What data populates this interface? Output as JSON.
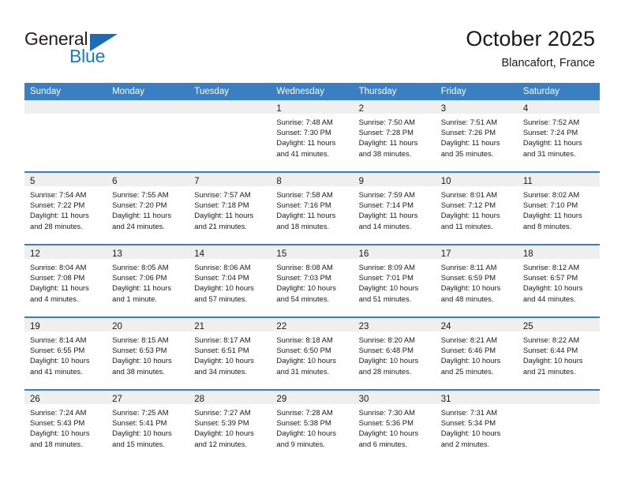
{
  "brand": {
    "name_part1": "General",
    "name_part2": "Blue",
    "logo_icon": "triangle-logo-icon",
    "color_text": "#231f20",
    "color_accent": "#1c79c0"
  },
  "header": {
    "title": "October 2025",
    "subtitle": "Blancafort, France"
  },
  "theme": {
    "header_row_bg": "#3a7fc1",
    "date_band_bg": "#efefef",
    "row_separator": "#3a7fc1",
    "text": "#1a1a1a"
  },
  "weekday_headers": [
    "Sunday",
    "Monday",
    "Tuesday",
    "Wednesday",
    "Thursday",
    "Friday",
    "Saturday"
  ],
  "labels": {
    "sunrise_prefix": "Sunrise:",
    "sunset_prefix": "Sunset:",
    "daylight_prefix": "Daylight:"
  },
  "weeks": [
    [
      {
        "empty": true
      },
      {
        "empty": true
      },
      {
        "empty": true
      },
      {
        "empty": false,
        "day": "1",
        "sunrise": "Sunrise: 7:48 AM",
        "sunset": "Sunset: 7:30 PM",
        "daylight_line1": "Daylight: 11 hours",
        "daylight_line2": "and 41 minutes."
      },
      {
        "empty": false,
        "day": "2",
        "sunrise": "Sunrise: 7:50 AM",
        "sunset": "Sunset: 7:28 PM",
        "daylight_line1": "Daylight: 11 hours",
        "daylight_line2": "and 38 minutes."
      },
      {
        "empty": false,
        "day": "3",
        "sunrise": "Sunrise: 7:51 AM",
        "sunset": "Sunset: 7:26 PM",
        "daylight_line1": "Daylight: 11 hours",
        "daylight_line2": "and 35 minutes."
      },
      {
        "empty": false,
        "day": "4",
        "sunrise": "Sunrise: 7:52 AM",
        "sunset": "Sunset: 7:24 PM",
        "daylight_line1": "Daylight: 11 hours",
        "daylight_line2": "and 31 minutes."
      }
    ],
    [
      {
        "empty": false,
        "day": "5",
        "sunrise": "Sunrise: 7:54 AM",
        "sunset": "Sunset: 7:22 PM",
        "daylight_line1": "Daylight: 11 hours",
        "daylight_line2": "and 28 minutes."
      },
      {
        "empty": false,
        "day": "6",
        "sunrise": "Sunrise: 7:55 AM",
        "sunset": "Sunset: 7:20 PM",
        "daylight_line1": "Daylight: 11 hours",
        "daylight_line2": "and 24 minutes."
      },
      {
        "empty": false,
        "day": "7",
        "sunrise": "Sunrise: 7:57 AM",
        "sunset": "Sunset: 7:18 PM",
        "daylight_line1": "Daylight: 11 hours",
        "daylight_line2": "and 21 minutes."
      },
      {
        "empty": false,
        "day": "8",
        "sunrise": "Sunrise: 7:58 AM",
        "sunset": "Sunset: 7:16 PM",
        "daylight_line1": "Daylight: 11 hours",
        "daylight_line2": "and 18 minutes."
      },
      {
        "empty": false,
        "day": "9",
        "sunrise": "Sunrise: 7:59 AM",
        "sunset": "Sunset: 7:14 PM",
        "daylight_line1": "Daylight: 11 hours",
        "daylight_line2": "and 14 minutes."
      },
      {
        "empty": false,
        "day": "10",
        "sunrise": "Sunrise: 8:01 AM",
        "sunset": "Sunset: 7:12 PM",
        "daylight_line1": "Daylight: 11 hours",
        "daylight_line2": "and 11 minutes."
      },
      {
        "empty": false,
        "day": "11",
        "sunrise": "Sunrise: 8:02 AM",
        "sunset": "Sunset: 7:10 PM",
        "daylight_line1": "Daylight: 11 hours",
        "daylight_line2": "and 8 minutes."
      }
    ],
    [
      {
        "empty": false,
        "day": "12",
        "sunrise": "Sunrise: 8:04 AM",
        "sunset": "Sunset: 7:08 PM",
        "daylight_line1": "Daylight: 11 hours",
        "daylight_line2": "and 4 minutes."
      },
      {
        "empty": false,
        "day": "13",
        "sunrise": "Sunrise: 8:05 AM",
        "sunset": "Sunset: 7:06 PM",
        "daylight_line1": "Daylight: 11 hours",
        "daylight_line2": "and 1 minute."
      },
      {
        "empty": false,
        "day": "14",
        "sunrise": "Sunrise: 8:06 AM",
        "sunset": "Sunset: 7:04 PM",
        "daylight_line1": "Daylight: 10 hours",
        "daylight_line2": "and 57 minutes."
      },
      {
        "empty": false,
        "day": "15",
        "sunrise": "Sunrise: 8:08 AM",
        "sunset": "Sunset: 7:03 PM",
        "daylight_line1": "Daylight: 10 hours",
        "daylight_line2": "and 54 minutes."
      },
      {
        "empty": false,
        "day": "16",
        "sunrise": "Sunrise: 8:09 AM",
        "sunset": "Sunset: 7:01 PM",
        "daylight_line1": "Daylight: 10 hours",
        "daylight_line2": "and 51 minutes."
      },
      {
        "empty": false,
        "day": "17",
        "sunrise": "Sunrise: 8:11 AM",
        "sunset": "Sunset: 6:59 PM",
        "daylight_line1": "Daylight: 10 hours",
        "daylight_line2": "and 48 minutes."
      },
      {
        "empty": false,
        "day": "18",
        "sunrise": "Sunrise: 8:12 AM",
        "sunset": "Sunset: 6:57 PM",
        "daylight_line1": "Daylight: 10 hours",
        "daylight_line2": "and 44 minutes."
      }
    ],
    [
      {
        "empty": false,
        "day": "19",
        "sunrise": "Sunrise: 8:14 AM",
        "sunset": "Sunset: 6:55 PM",
        "daylight_line1": "Daylight: 10 hours",
        "daylight_line2": "and 41 minutes."
      },
      {
        "empty": false,
        "day": "20",
        "sunrise": "Sunrise: 8:15 AM",
        "sunset": "Sunset: 6:53 PM",
        "daylight_line1": "Daylight: 10 hours",
        "daylight_line2": "and 38 minutes."
      },
      {
        "empty": false,
        "day": "21",
        "sunrise": "Sunrise: 8:17 AM",
        "sunset": "Sunset: 6:51 PM",
        "daylight_line1": "Daylight: 10 hours",
        "daylight_line2": "and 34 minutes."
      },
      {
        "empty": false,
        "day": "22",
        "sunrise": "Sunrise: 8:18 AM",
        "sunset": "Sunset: 6:50 PM",
        "daylight_line1": "Daylight: 10 hours",
        "daylight_line2": "and 31 minutes."
      },
      {
        "empty": false,
        "day": "23",
        "sunrise": "Sunrise: 8:20 AM",
        "sunset": "Sunset: 6:48 PM",
        "daylight_line1": "Daylight: 10 hours",
        "daylight_line2": "and 28 minutes."
      },
      {
        "empty": false,
        "day": "24",
        "sunrise": "Sunrise: 8:21 AM",
        "sunset": "Sunset: 6:46 PM",
        "daylight_line1": "Daylight: 10 hours",
        "daylight_line2": "and 25 minutes."
      },
      {
        "empty": false,
        "day": "25",
        "sunrise": "Sunrise: 8:22 AM",
        "sunset": "Sunset: 6:44 PM",
        "daylight_line1": "Daylight: 10 hours",
        "daylight_line2": "and 21 minutes."
      }
    ],
    [
      {
        "empty": false,
        "day": "26",
        "sunrise": "Sunrise: 7:24 AM",
        "sunset": "Sunset: 5:43 PM",
        "daylight_line1": "Daylight: 10 hours",
        "daylight_line2": "and 18 minutes."
      },
      {
        "empty": false,
        "day": "27",
        "sunrise": "Sunrise: 7:25 AM",
        "sunset": "Sunset: 5:41 PM",
        "daylight_line1": "Daylight: 10 hours",
        "daylight_line2": "and 15 minutes."
      },
      {
        "empty": false,
        "day": "28",
        "sunrise": "Sunrise: 7:27 AM",
        "sunset": "Sunset: 5:39 PM",
        "daylight_line1": "Daylight: 10 hours",
        "daylight_line2": "and 12 minutes."
      },
      {
        "empty": false,
        "day": "29",
        "sunrise": "Sunrise: 7:28 AM",
        "sunset": "Sunset: 5:38 PM",
        "daylight_line1": "Daylight: 10 hours",
        "daylight_line2": "and 9 minutes."
      },
      {
        "empty": false,
        "day": "30",
        "sunrise": "Sunrise: 7:30 AM",
        "sunset": "Sunset: 5:36 PM",
        "daylight_line1": "Daylight: 10 hours",
        "daylight_line2": "and 6 minutes."
      },
      {
        "empty": false,
        "day": "31",
        "sunrise": "Sunrise: 7:31 AM",
        "sunset": "Sunset: 5:34 PM",
        "daylight_line1": "Daylight: 10 hours",
        "daylight_line2": "and 2 minutes."
      },
      {
        "empty": true
      }
    ]
  ]
}
